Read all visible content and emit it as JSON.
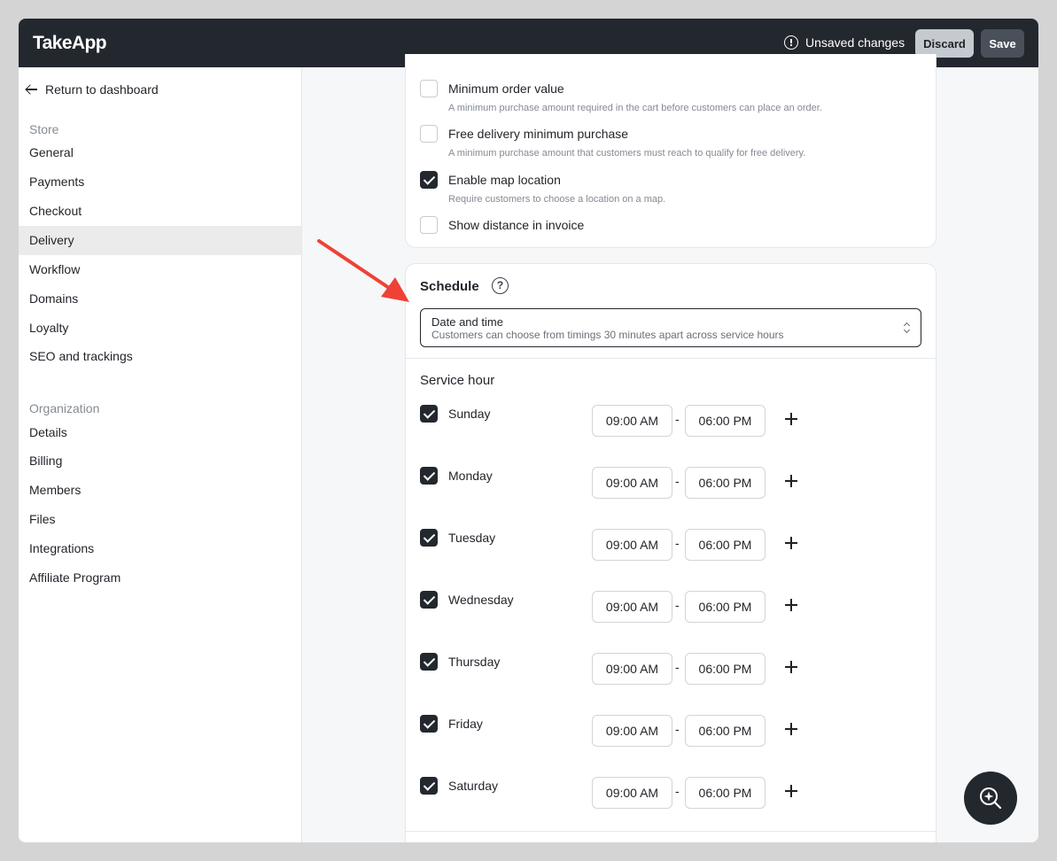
{
  "app": {
    "logo": "TakeApp"
  },
  "header": {
    "unsaved_text": "Unsaved changes",
    "discard_label": "Discard",
    "save_label": "Save"
  },
  "sidebar": {
    "back_label": "Return to dashboard",
    "store_label": "Store",
    "store_items": [
      "General",
      "Payments",
      "Checkout",
      "Delivery",
      "Workflow",
      "Domains",
      "Loyalty",
      "SEO and trackings"
    ],
    "active_item": "Delivery",
    "org_label": "Organization",
    "org_items": [
      "Details",
      "Billing",
      "Members",
      "Files",
      "Integrations",
      "Affiliate Program"
    ]
  },
  "options": [
    {
      "title": "Minimum order value",
      "desc": "A minimum purchase amount required in the cart before customers can place an order.",
      "checked": false
    },
    {
      "title": "Free delivery minimum purchase",
      "desc": "A minimum purchase amount that customers must reach to qualify for free delivery.",
      "checked": false
    },
    {
      "title": "Enable map location",
      "desc": "Require customers to choose a location on a map.",
      "checked": true
    },
    {
      "title": "Show distance in invoice",
      "desc": "",
      "checked": false
    }
  ],
  "schedule": {
    "title": "Schedule",
    "help": "?",
    "select_label": "Date and time",
    "select_desc": "Customers can choose from timings 30 minutes apart across service hours",
    "service_hour_title": "Service hour",
    "days": [
      {
        "name": "Sunday",
        "start": "09:00 AM",
        "end": "06:00 PM",
        "checked": true
      },
      {
        "name": "Monday",
        "start": "09:00 AM",
        "end": "06:00 PM",
        "checked": true
      },
      {
        "name": "Tuesday",
        "start": "09:00 AM",
        "end": "06:00 PM",
        "checked": true
      },
      {
        "name": "Wednesday",
        "start": "09:00 AM",
        "end": "06:00 PM",
        "checked": true
      },
      {
        "name": "Thursday",
        "start": "09:00 AM",
        "end": "06:00 PM",
        "checked": true
      },
      {
        "name": "Friday",
        "start": "09:00 AM",
        "end": "06:00 PM",
        "checked": true
      },
      {
        "name": "Saturday",
        "start": "09:00 AM",
        "end": "06:00 PM",
        "checked": true
      }
    ],
    "separator": "-"
  },
  "colors": {
    "header_bg": "#23272e",
    "annotation_arrow": "#ef4136",
    "active_nav_bg": "#ebebeb"
  },
  "icons": {
    "unsaved": "alert-circle-icon",
    "back": "arrow-left-icon",
    "help": "question-circle-icon",
    "select_caret": "chevron-up-down-icon",
    "add": "plus-icon",
    "fab": "sparkle-search-icon"
  }
}
